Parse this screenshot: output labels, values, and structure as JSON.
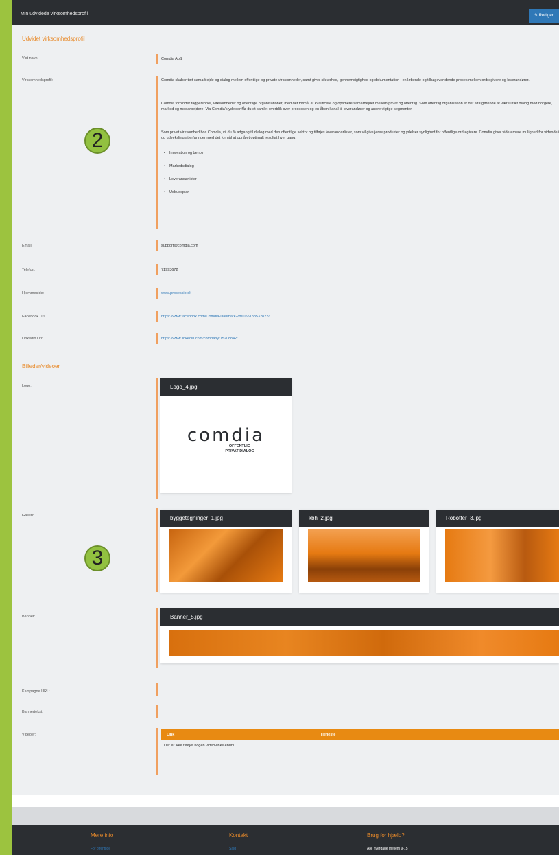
{
  "topbar": {
    "title": "Min udvidede virksomhedsprofil",
    "edit_label": "Rediger"
  },
  "section1_title": "Udvidet virksomhedsprofil",
  "fields": {
    "vist_navn": {
      "label": "Vist navn:",
      "value": "Comdia ApS"
    },
    "profil": {
      "label": "Virksomhedsprofil:",
      "paragraphs": [
        "Comdia skaber tæt samarbejde og dialog mellem offentlige og private virksomheder, samt giver sikkerhed, gennemsigtighed og dokumentation i en løbende og tilbagevendende proces mellem ordregivere og leverandører.",
        "Comdia forbinder fagpersoner, virksomheder og offentlige organisationer, med det formål at kvalificere og optimere samarbejdet mellem privat og offentlig. Som offentlig organisation er det altafgørende at være i tæt dialog med borgere, marked og medarbejdere. Via Comdia's ydelser får du et samlet overblik over processen og en åben kanal til leverandører og andre vigtige segmenter.",
        "Som privat virksomhed hos Comdia, vil du få adgang til dialog med den offentlige sektor og tilføjes leverandørlister, som vil give jeres produkter og ydelser synlighed for offentlige ordregivere. Comdia giver videremere mulighed for videndeling og udveksling at erfaringer med det formål at opnå et optimalt resultat hver gang."
      ],
      "bullets": [
        "Innovation og behov",
        "Markedsdialog",
        "Leverandørlister",
        "Udbudsplan"
      ]
    },
    "email": {
      "label": "Email:",
      "value": "support@comdia.com"
    },
    "telefon": {
      "label": "Telefon:",
      "value": "71993672"
    },
    "hjemmeside": {
      "label": "Hjemmeside:",
      "value": "www.processio.dk"
    },
    "facebook": {
      "label": "Facebook Url:",
      "value": "https://www.facebook.com/Comdia-Danmark-286055188532822/"
    },
    "linkedin": {
      "label": "Linkedin Url:",
      "value": "https://www.linkedin.com/company/15208842/"
    }
  },
  "section2_title": "Billeder/videoer",
  "media": {
    "logo": {
      "label": "Logo:",
      "filename": "Logo_4.jpg",
      "logo_word": "comdia",
      "logo_sub1": "OFFENTLIG",
      "logo_sub2": "PRIVAT DIALOG"
    },
    "galleri": {
      "label": "Galleri:",
      "files": [
        "byggetegninger_1.jpg",
        "kbh_2.jpg",
        "Robotter_3.jpg"
      ]
    },
    "banner": {
      "label": "Banner:",
      "filename": "Banner_5.jpg"
    },
    "kampagne": {
      "label": "Kampagne URL:"
    },
    "bannertekst": {
      "label": "Bannertekst:"
    },
    "videoer": {
      "label": "Videoer:",
      "col_link": "Link",
      "col_tjeneste": "Tjeneste",
      "empty": "Der er ikke tilføjet nogen video-links endnu"
    }
  },
  "badges": [
    "2",
    "3"
  ],
  "footer": {
    "col1_title": "Mere info",
    "col1_link": "For offentlige",
    "col2_title": "Kontakt",
    "col2_link": "Salg",
    "col3_title": "Brug for hjælp?",
    "col3_text": "Alle hverdage mellem 9-15"
  },
  "colors": {
    "accent": "#e88a2a",
    "dark": "#2b2e32",
    "link": "#2f78b7",
    "frame": "#9cc33f"
  }
}
